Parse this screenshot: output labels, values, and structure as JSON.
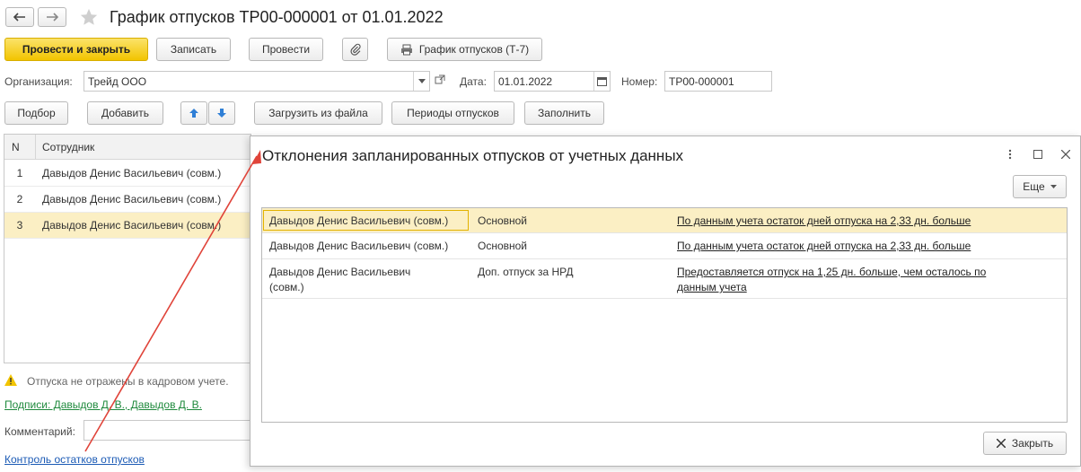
{
  "window": {
    "title": "График отпусков ТР00-000001 от 01.01.2022",
    "back_icon": "arrow-left-icon",
    "forward_icon": "arrow-right-icon",
    "star_icon": "star-icon"
  },
  "toolbar": {
    "post_and_close": "Провести и закрыть",
    "save": "Записать",
    "post": "Провести",
    "print_schedule": "График отпусков (Т-7)"
  },
  "form": {
    "org_label": "Организация:",
    "org_value": "Трейд ООО",
    "date_label": "Дата:",
    "date_value": "01.01.2022",
    "number_label": "Номер:",
    "number_value": "ТР00-000001"
  },
  "table_toolbar": {
    "select": "Подбор",
    "add": "Добавить",
    "load_from_file": "Загрузить из файла",
    "vacation_periods": "Периоды отпусков",
    "fill": "Заполнить"
  },
  "employees_table": {
    "columns": [
      "N",
      "Сотрудник"
    ],
    "rows": [
      {
        "n": "1",
        "name": "Давыдов Денис Васильевич (совм.)"
      },
      {
        "n": "2",
        "name": "Давыдов Денис Васильевич (совм.)"
      },
      {
        "n": "3",
        "name": "Давыдов Денис Васильевич (совм.)"
      }
    ]
  },
  "footer": {
    "warning": "Отпуска не отражены в кадровом учете.",
    "signatures": "Подписи: Давыдов Д. В., Давыдов Д. В.",
    "comment_label": "Комментарий:",
    "control_link": "Контроль остатков отпусков"
  },
  "dialog": {
    "title": "Отклонения запланированных отпусков от учетных данных",
    "more": "Еще",
    "close": "Закрыть",
    "rows": [
      {
        "employee": "Давыдов Денис Васильевич (совм.)",
        "type": "Основной",
        "message": "По данным учета остаток дней отпуска на 2,33 дн. больше"
      },
      {
        "employee": "Давыдов Денис Васильевич (совм.)",
        "type": "Основной",
        "message": "По данным учета остаток дней отпуска на 2,33 дн. больше"
      },
      {
        "employee": "Давыдов Денис Васильевич (совм.)",
        "type": "Доп. отпуск за НРД",
        "message": "Предоставляется отпуск на 1,25 дн. больше, чем осталось по данным учета"
      }
    ]
  },
  "colors": {
    "primary_button": "#f2c400",
    "selected_row": "#fbefc4",
    "link": "#1c5bb5",
    "green_link": "#1f8a3d",
    "arrow": "#e0443a"
  }
}
